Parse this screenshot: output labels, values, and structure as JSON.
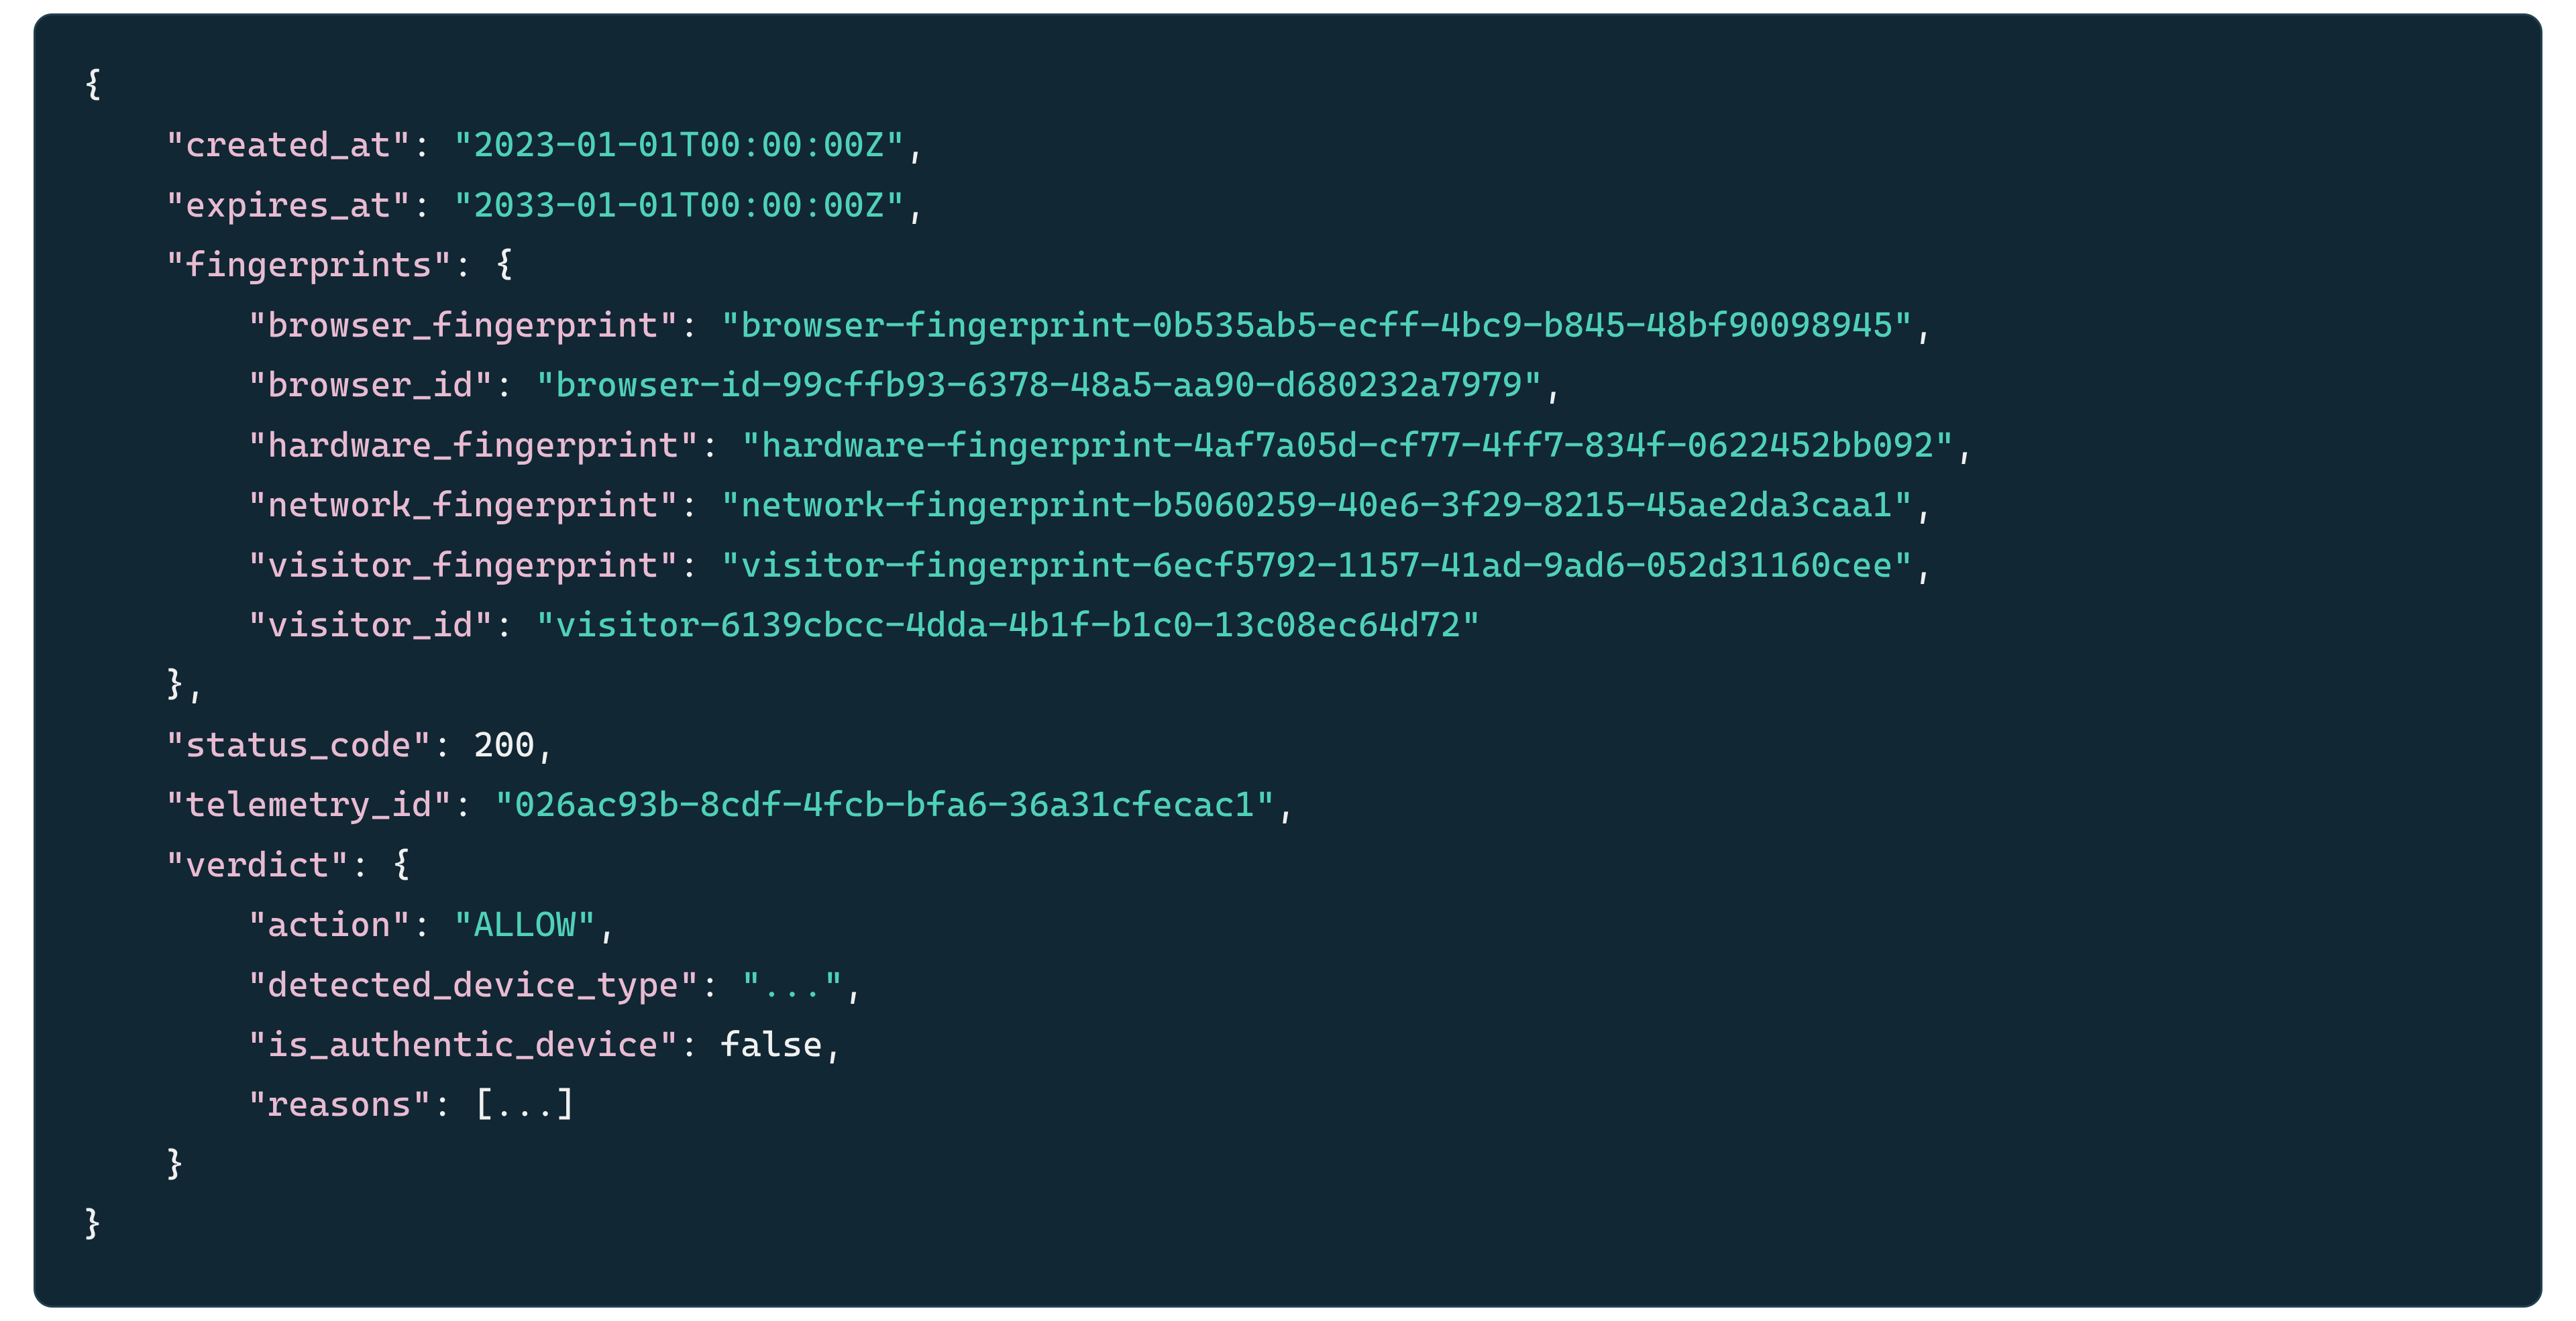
{
  "code": {
    "indent": "    ",
    "created_at_key": "created_at",
    "created_at_val": "2023-01-01T00:00:00Z",
    "expires_at_key": "expires_at",
    "expires_at_val": "2033-01-01T00:00:00Z",
    "fingerprints_key": "fingerprints",
    "fp_browser_fingerprint_key": "browser_fingerprint",
    "fp_browser_fingerprint_val": "browser-fingerprint-0b535ab5-ecff-4bc9-b845-48bf90098945",
    "fp_browser_id_key": "browser_id",
    "fp_browser_id_val": "browser-id-99cffb93-6378-48a5-aa90-d680232a7979",
    "fp_hardware_fingerprint_key": "hardware_fingerprint",
    "fp_hardware_fingerprint_val": "hardware-fingerprint-4af7a05d-cf77-4ff7-834f-0622452bb092",
    "fp_network_fingerprint_key": "network_fingerprint",
    "fp_network_fingerprint_val": "network-fingerprint-b5060259-40e6-3f29-8215-45ae2da3caa1",
    "fp_visitor_fingerprint_key": "visitor_fingerprint",
    "fp_visitor_fingerprint_val": "visitor-fingerprint-6ecf5792-1157-41ad-9ad6-052d31160cee",
    "fp_visitor_id_key": "visitor_id",
    "fp_visitor_id_val": "visitor-6139cbcc-4dda-4b1f-b1c0-13c08ec64d72",
    "status_code_key": "status_code",
    "status_code_val": "200",
    "telemetry_id_key": "telemetry_id",
    "telemetry_id_val": "026ac93b-8cdf-4fcb-bfa6-36a31cfecac1",
    "verdict_key": "verdict",
    "v_action_key": "action",
    "v_action_val": "ALLOW",
    "v_detected_device_type_key": "detected_device_type",
    "v_detected_device_type_val": "...",
    "v_is_authentic_device_key": "is_authentic_device",
    "v_is_authentic_device_val": "false",
    "v_reasons_key": "reasons",
    "v_reasons_val": "[...]"
  }
}
